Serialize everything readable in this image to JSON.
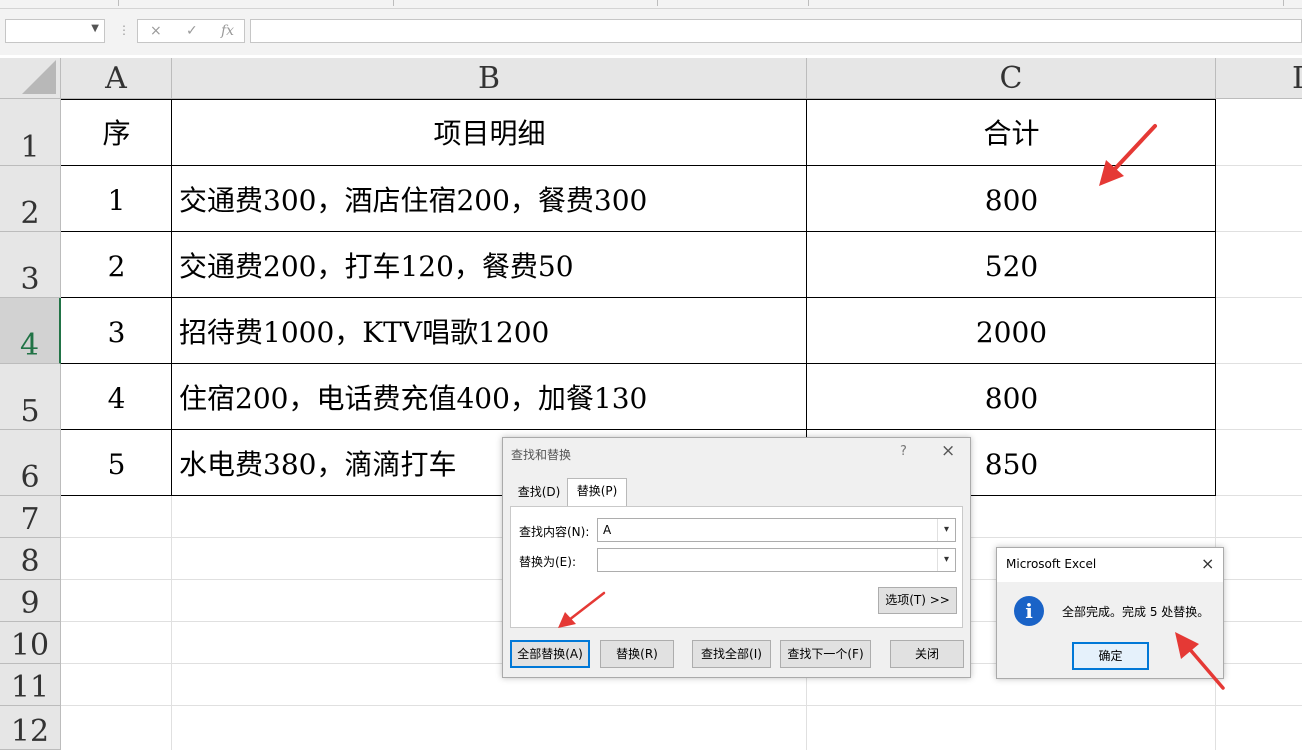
{
  "formula_bar": {
    "cancel_icon": "×",
    "enter_icon": "✓",
    "fx_label": "fx",
    "formula": ""
  },
  "sheet": {
    "columns": [
      "A",
      "B",
      "C",
      "D"
    ],
    "rows": [
      "1",
      "2",
      "3",
      "4",
      "5",
      "6",
      "7",
      "8",
      "9",
      "10",
      "11",
      "12"
    ],
    "selected_row": "4",
    "header": {
      "a": "序",
      "b": "项目明细",
      "c": "合计"
    },
    "data": [
      {
        "a": "1",
        "b": "交通费300，酒店住宿200，餐费300",
        "c": "800"
      },
      {
        "a": "2",
        "b": "交通费200，打车120，餐费50",
        "c": "520"
      },
      {
        "a": "3",
        "b": "招待费1000，KTV唱歌1200",
        "c": "2000"
      },
      {
        "a": "4",
        "b": "住宿200，电话费充值400，加餐130",
        "c": "800"
      },
      {
        "a": "5",
        "b": "水电费380，滴滴打车",
        "c": "850"
      }
    ]
  },
  "find_replace_dialog": {
    "title": "查找和替换",
    "help": "?",
    "close": "×",
    "tab_find": "查找(D)",
    "tab_replace": "替换(P)",
    "find_label": "查找内容(N):",
    "find_value": "A",
    "replace_label": "替换为(E):",
    "replace_value": "",
    "options_button": "选项(T) >>",
    "replace_all_button": "全部替换(A)",
    "replace_button": "替换(R)",
    "find_all_button": "查找全部(I)",
    "find_next_button": "查找下一个(F)",
    "close_button": "关闭"
  },
  "message_box": {
    "title": "Microsoft Excel",
    "close": "×",
    "icon": "info-icon",
    "text": "全部完成。完成 5 处替换。",
    "ok_button": "确定"
  },
  "colors": {
    "arrow": "#e53935",
    "accent": "#0078d7",
    "selected_row_text": "#217346"
  }
}
